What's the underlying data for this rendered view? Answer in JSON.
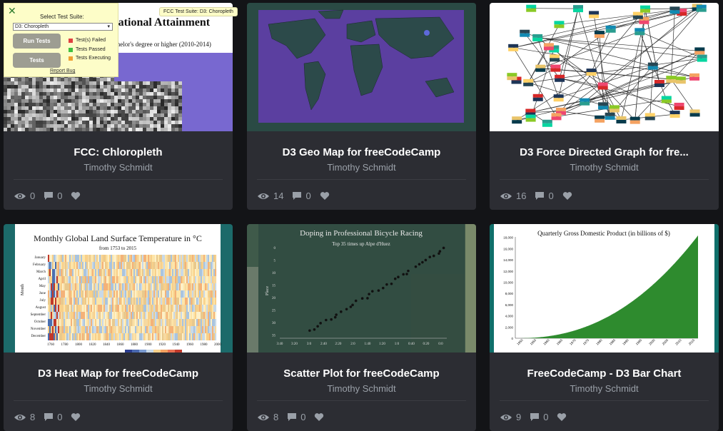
{
  "cards": [
    {
      "title": "FCC: Chloropleth",
      "author": "Timothy Schmidt",
      "views": "0",
      "comments": "0"
    },
    {
      "title": "D3 Geo Map for freeCodeCamp",
      "author": "Timothy Schmidt",
      "views": "14",
      "comments": "0"
    },
    {
      "title": "D3 Force Directed Graph for fre...",
      "author": "Timothy Schmidt",
      "views": "16",
      "comments": "0"
    },
    {
      "title": "D3 Heat Map for freeCodeCamp",
      "author": "Timothy Schmidt",
      "views": "8",
      "comments": "0"
    },
    {
      "title": "Scatter Plot for freeCodeCamp",
      "author": "Timothy Schmidt",
      "views": "8",
      "comments": "0"
    },
    {
      "title": "FreeCodeCamp - D3 Bar Chart",
      "author": "Timothy Schmidt",
      "views": "9",
      "comments": "0"
    }
  ],
  "fcc_panel": {
    "suite_label": "Select Test Suite:",
    "suite_value": "D3: Choropleth",
    "run_tests": "Run Tests",
    "tests": "Tests",
    "legend_failed": "Test(s) Failed",
    "legend_passed": "Tests Passed",
    "legend_executing": "Tests Executing",
    "report_bug": "Report Bug",
    "tooltip": "FCC Test Suite: D3: Choropleth"
  },
  "previews": {
    "choropleth_title": "United States Educational Attainment",
    "choropleth_sub": "a bachelor's degree or higher (2010-2014)",
    "heatmap_title": "Monthly Global Land Surface Temperature in °C",
    "heatmap_sub": "from 1753 to 2015",
    "heatmap_ylabel": "Month",
    "heatmap_months": [
      "January",
      "February",
      "March",
      "April",
      "May",
      "June",
      "July",
      "August",
      "September",
      "October",
      "November",
      "December"
    ],
    "heatmap_years": [
      "1760",
      "1780",
      "1800",
      "1820",
      "1840",
      "1860",
      "1880",
      "1900",
      "1920",
      "1940",
      "1960",
      "1980",
      "2000"
    ],
    "scatter_title": "Doping in Professional Bicycle Racing",
    "scatter_sub": "Top 35 times up Alpe d'Huez",
    "scatter_ylabel": "Place",
    "scatter_yticks": [
      "0",
      "5",
      "10",
      "15",
      "20",
      "25",
      "30",
      "35"
    ],
    "scatter_xticks": [
      "3:40",
      "3:20",
      "3:0",
      "2:40",
      "2:20",
      "2:0",
      "1:40",
      "1:20",
      "1:0",
      "0:40",
      "0:20",
      "0:0"
    ],
    "bar_title": "Quarterly Gross Domestic Product (in billions of $)",
    "bar_yticks": [
      "0",
      "2,000",
      "4,000",
      "6,000",
      "8,000",
      "10,000",
      "12,000",
      "14,000",
      "16,000",
      "18,000"
    ],
    "bar_xticks": [
      "1950",
      "1955",
      "1960",
      "1965",
      "1970",
      "1975",
      "1980",
      "1985",
      "1990",
      "1995",
      "2000",
      "2005",
      "2010",
      "2015"
    ]
  },
  "colors": {
    "page_bg": "#131417",
    "card_bg": "#2c2d33",
    "title": "#ffffff",
    "muted": "#9aa0a8",
    "map_ocean": "#5b3fa0",
    "map_land": "#2c4a4a",
    "bar_green": "#2e8b2e",
    "teal": "#1c6a6a"
  }
}
